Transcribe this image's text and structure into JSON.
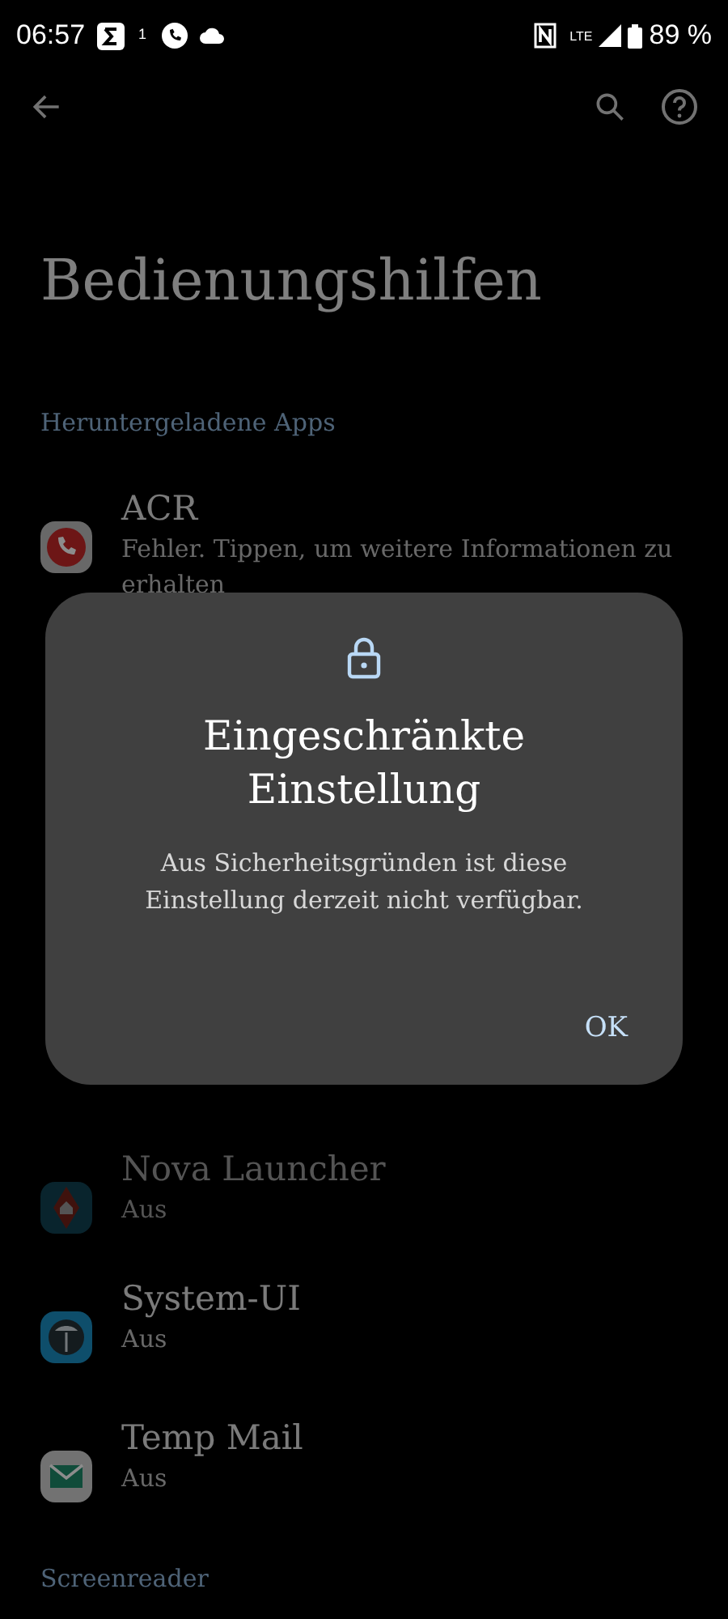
{
  "status_bar": {
    "time": "06:57",
    "notification_count": "1",
    "network": "LTE",
    "battery": "89 %"
  },
  "page": {
    "title": "Bedienungshilfen",
    "section": "Heruntergeladene Apps"
  },
  "apps": [
    {
      "name": "ACR",
      "summary": "Fehler. Tippen, um weitere Informationen zu erhalten",
      "disabled": false
    },
    {
      "name": "Nova Launcher",
      "summary": "Aus",
      "disabled": true
    },
    {
      "name": "System-UI",
      "summary": "Aus",
      "disabled": false
    },
    {
      "name": "Temp Mail",
      "summary": "Aus",
      "disabled": false
    }
  ],
  "next_section": "Screenreader",
  "dialog": {
    "title": "Eingeschränkte Einstellung",
    "message": "Aus Sicherheitsgründen ist diese Einstellung derzeit nicht verfügbar.",
    "button": "OK"
  }
}
